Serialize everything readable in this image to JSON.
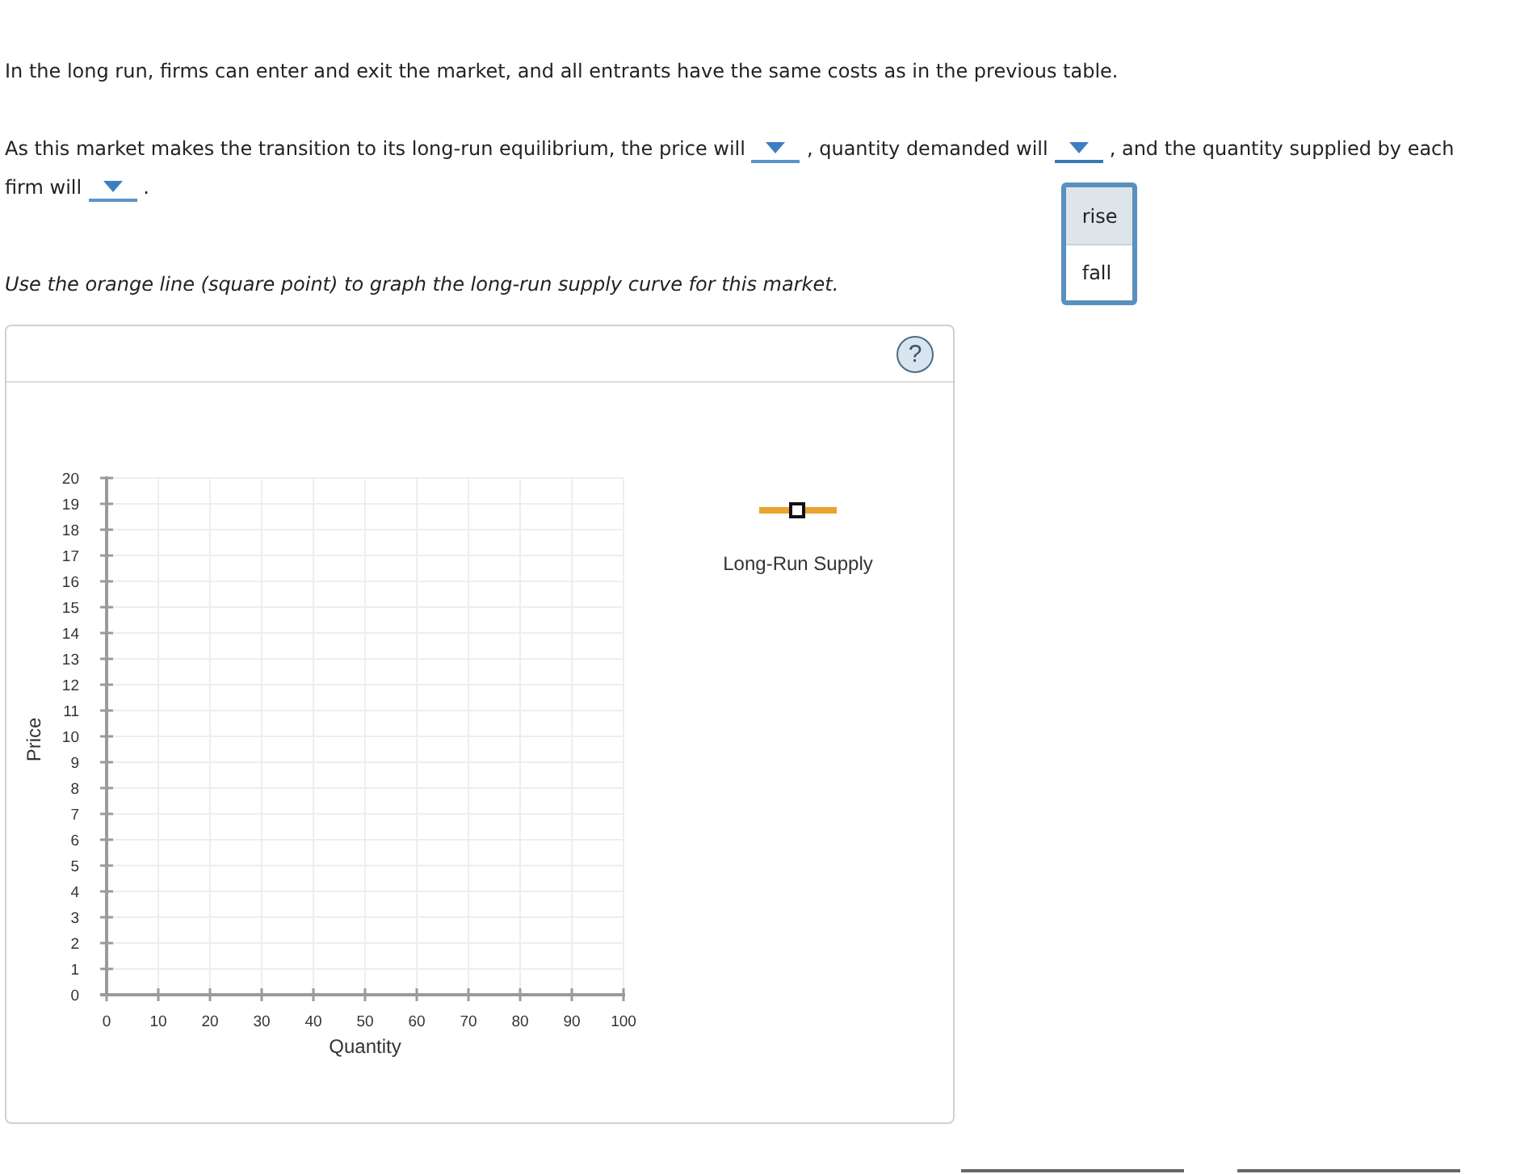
{
  "intro": {
    "text": "In the long run, firms can enter and exit the market, and all entrants have the same costs as in the previous table."
  },
  "question": {
    "lines": [
      [
        {
          "kind": "text",
          "text": "As this market makes the transition to its long-run equilibrium, the price will"
        },
        {
          "kind": "dropdown",
          "expanded": false
        },
        {
          "kind": "text",
          "text": ", quantity demanded will"
        },
        {
          "kind": "dropdown",
          "expanded": true,
          "options": [
            {
              "label": "rise",
              "selected": true
            },
            {
              "label": "fall",
              "selected": false
            }
          ]
        },
        {
          "kind": "text",
          "text": ", and the quantity supplied by each"
        }
      ],
      [
        {
          "kind": "text",
          "text": "firm will"
        },
        {
          "kind": "dropdown",
          "expanded": false
        },
        {
          "kind": "text",
          "text": "."
        }
      ]
    ]
  },
  "instruction": {
    "text": "Use the orange line (square point) to graph the long-run supply curve for this market."
  },
  "graph_panel": {
    "help_button": {
      "label": "?"
    },
    "chart_data": {
      "type": "line",
      "xlabel": "Quantity",
      "ylabel": "Price",
      "xlim": [
        0,
        100
      ],
      "ylim": [
        0,
        20
      ],
      "xticks": [
        0,
        10,
        20,
        30,
        40,
        50,
        60,
        70,
        80,
        90,
        100
      ],
      "yticks": [
        0,
        1,
        2,
        3,
        4,
        5,
        6,
        7,
        8,
        9,
        10,
        11,
        12,
        13,
        14,
        15,
        16,
        17,
        18,
        19,
        20
      ],
      "grid": true
    },
    "legend": [
      {
        "label": "Long-Run Supply"
      }
    ]
  }
}
